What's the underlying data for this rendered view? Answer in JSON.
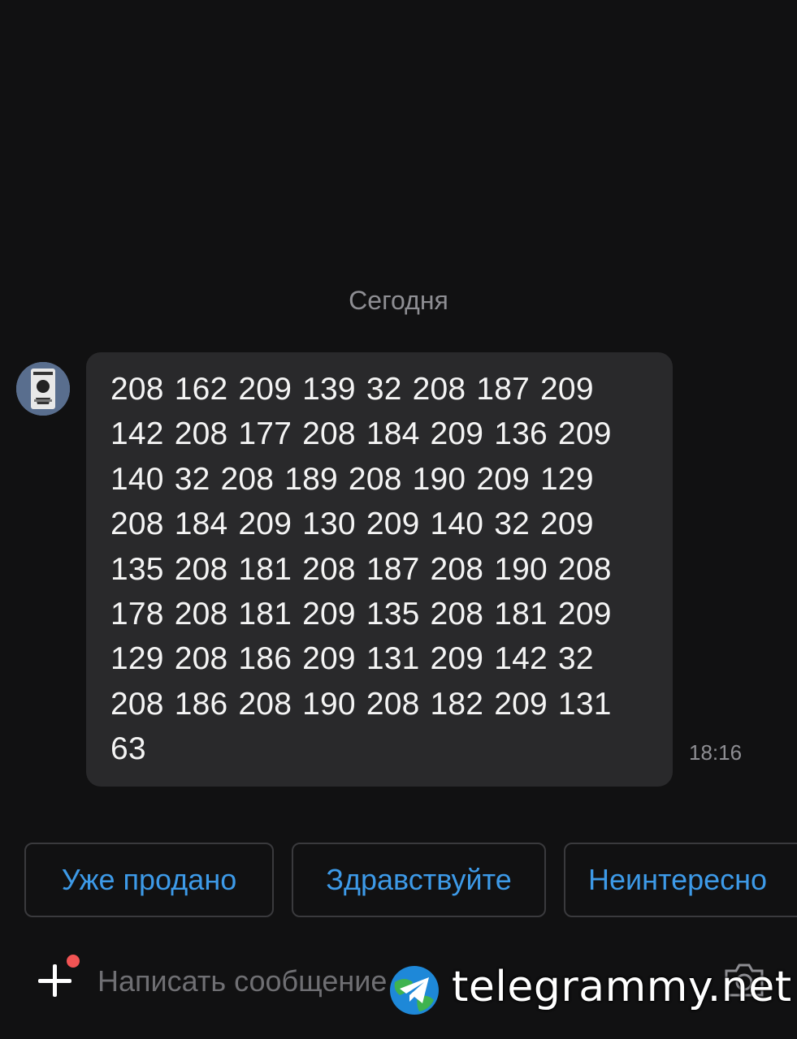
{
  "chat": {
    "date_separator": "Сегодня",
    "message": {
      "lines": [
        "208 162 209 139 32 208 187 209",
        "142 208 177 208 184 209 136 209",
        "140 32 208 189 208 190 209 129",
        "208 184 209 130 209 140 32 209",
        "135 208 181 208 187 208 190 208",
        "178 208 181 209 135 208 181 209",
        "129 208 186 209 131 209 142 32",
        "208 186 208 190 208 182 209 131",
        "63"
      ],
      "time": "18:16"
    }
  },
  "quick_replies": [
    "Уже продано",
    "Здравствуйте",
    "Неинтересно"
  ],
  "composer": {
    "placeholder": "Написать сообщение",
    "plus_icon": "plus-icon",
    "camera_icon": "camera-icon"
  },
  "watermark": {
    "text": "telegrammy.net"
  },
  "colors": {
    "background": "#111112",
    "bubble": "#29292b",
    "accent": "#3d9ae8",
    "notification_dot": "#f25454",
    "muted": "#8e8e93"
  }
}
